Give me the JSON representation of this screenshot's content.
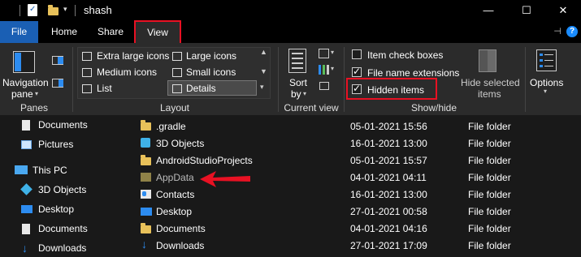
{
  "title_bar": {
    "title": "shash",
    "minimize": "—",
    "maximize": "☐",
    "close": "✕"
  },
  "tabs": {
    "file": "File",
    "home": "Home",
    "share": "Share",
    "view": "View",
    "pin": "⊣",
    "help": "?"
  },
  "ribbon": {
    "panes": {
      "navigation_pane_line1": "Navigation",
      "navigation_pane_line2": "pane",
      "group_label": "Panes"
    },
    "layout": {
      "items": [
        "Extra large icons",
        "Large icons",
        "Medium icons",
        "Small icons",
        "List",
        "Details"
      ],
      "selected": "Details",
      "group_label": "Layout"
    },
    "current_view": {
      "sort_line1": "Sort",
      "sort_line2": "by",
      "group_label": "Current view"
    },
    "show_hide": {
      "item_check_boxes": "Item check boxes",
      "file_name_extensions": "File name extensions",
      "hidden_items": "Hidden items",
      "item_check_boxes_checked": false,
      "file_name_extensions_checked": true,
      "hidden_items_checked": true,
      "hide_selected_line1": "Hide selected",
      "hide_selected_line2": "items",
      "group_label": "Show/hide"
    },
    "options": {
      "label": "Options"
    }
  },
  "nav_pane": {
    "items": [
      {
        "label": "Documents",
        "icon": "documents-icon"
      },
      {
        "label": "Pictures",
        "icon": "pictures-icon"
      },
      {
        "label": "This PC",
        "icon": "pc-icon"
      },
      {
        "label": "3D Objects",
        "icon": "3d-objects-icon"
      },
      {
        "label": "Desktop",
        "icon": "desktop-icon"
      },
      {
        "label": "Documents",
        "icon": "documents-icon"
      },
      {
        "label": "Downloads",
        "icon": "downloads-icon"
      }
    ]
  },
  "files": [
    {
      "name": ".gradle",
      "date": "05-01-2021 15:56",
      "type": "File folder",
      "icon": "folder-icon"
    },
    {
      "name": "3D Objects",
      "date": "16-01-2021 13:00",
      "type": "File folder",
      "icon": "3d-objects-icon"
    },
    {
      "name": "AndroidStudioProjects",
      "date": "05-01-2021 15:57",
      "type": "File folder",
      "icon": "folder-icon"
    },
    {
      "name": "AppData",
      "date": "04-01-2021 04:11",
      "type": "File folder",
      "icon": "hidden-folder-icon"
    },
    {
      "name": "Contacts",
      "date": "16-01-2021 13:00",
      "type": "File folder",
      "icon": "contacts-icon"
    },
    {
      "name": "Desktop",
      "date": "27-01-2021 00:58",
      "type": "File folder",
      "icon": "desktop-icon"
    },
    {
      "name": "Documents",
      "date": "04-01-2021 04:16",
      "type": "File folder",
      "icon": "documents-folder-icon"
    },
    {
      "name": "Downloads",
      "date": "27-01-2021 17:09",
      "type": "File folder",
      "icon": "downloads-icon"
    }
  ],
  "colors": {
    "accent_file_tab": "#1a5fb4",
    "highlight_red": "#e81123",
    "folder_yellow": "#e8c15a"
  }
}
